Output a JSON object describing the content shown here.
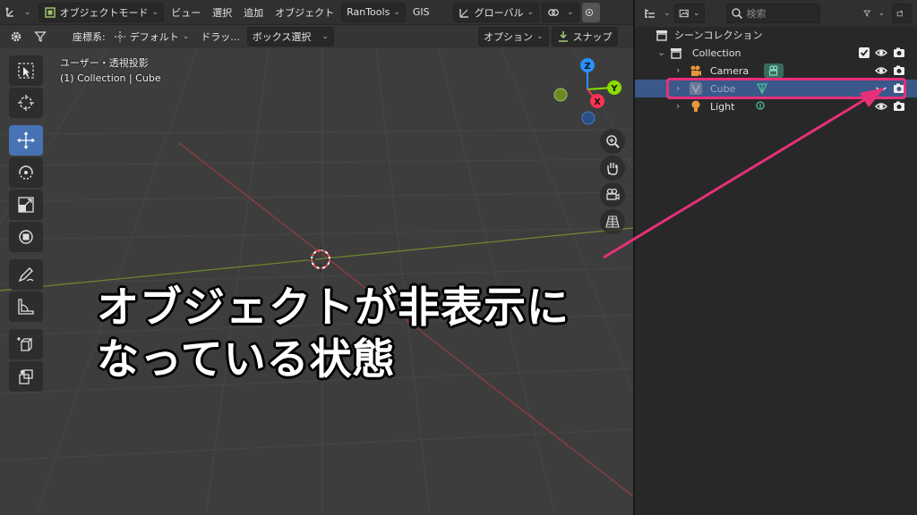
{
  "header": {
    "mode": "オブジェクトモード",
    "menus": [
      "ビュー",
      "選択",
      "追加",
      "オブジェクト"
    ],
    "addon": "RanTools",
    "gis": "GIS",
    "transform_orientation": "グローバル"
  },
  "header2": {
    "coord_label": "座標系:",
    "coord_value": "デフォルト",
    "drag_label": "ドラッ...",
    "select_mode": "ボックス選択",
    "options": "オプション",
    "snap": "スナップ"
  },
  "viewport": {
    "view_name": "ユーザー・透視投影",
    "object_info": "(1) Collection | Cube",
    "gizmo_axes": [
      "Z",
      "Y",
      "X"
    ]
  },
  "caption": {
    "line1": "オブジェクトが非表示に",
    "line2": "なっている状態"
  },
  "outliner": {
    "search_placeholder": "検索",
    "scene_collection": "シーンコレクション",
    "collection": "Collection",
    "items": [
      {
        "name": "Camera",
        "hidden": false,
        "selected": false
      },
      {
        "name": "Cube",
        "hidden": true,
        "selected": true
      },
      {
        "name": "Light",
        "hidden": false,
        "selected": false
      }
    ]
  },
  "colors": {
    "accent_highlight": "#e6307a",
    "selection": "#3b588a",
    "axis_x": "#ff3352",
    "axis_y": "#8bdc00",
    "axis_z": "#2890ff"
  }
}
